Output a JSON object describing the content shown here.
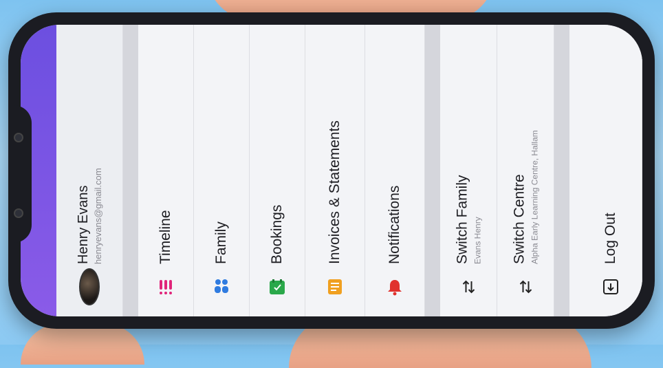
{
  "profile": {
    "name": "Henry Evans",
    "email": "henryevans@gmail.com"
  },
  "menu": [
    {
      "label": "Timeline",
      "icon": "timeline-icon",
      "color": "#e0247a"
    },
    {
      "label": "Family",
      "icon": "family-icon",
      "color": "#2f7be0"
    },
    {
      "label": "Bookings",
      "icon": "bookings-icon",
      "color": "#2aa84a"
    },
    {
      "label": "Invoices & Statements",
      "icon": "invoice-icon",
      "color": "#f0a020"
    },
    {
      "label": "Notifications",
      "icon": "bell-icon",
      "color": "#e0322e"
    }
  ],
  "switch_family": {
    "label": "Switch Family",
    "sub": "Evans Henry"
  },
  "switch_centre": {
    "label": "Switch Centre",
    "sub": "Alpha Early Learning Centre, Hallam"
  },
  "logout": {
    "label": "Log Out"
  },
  "colors": {
    "accent": "#6c4fe0",
    "background": "#eeeff3"
  }
}
